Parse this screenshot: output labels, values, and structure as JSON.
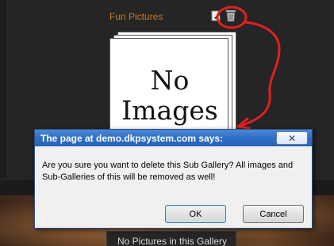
{
  "gallery": {
    "album_title": "Fun Pictures",
    "no_images_line1": "No",
    "no_images_line2": "Images",
    "no_pictures_text": "No Pictures in this Gallery",
    "icons": [
      "edit-icon",
      "trash-icon"
    ]
  },
  "dialog": {
    "title": "The page at demo.dkpsystem.com says:",
    "close_glyph": "✕",
    "message": "Are you sure you want to delete this Sub Gallery?  All images and Sub-Galleries of this will be removed as well!",
    "ok_label": "OK",
    "cancel_label": "Cancel"
  },
  "colors": {
    "background": "#252525",
    "album_title": "#c8792a",
    "annotation": "#e02020",
    "dialog_title_bar": "#2f6ec5"
  }
}
